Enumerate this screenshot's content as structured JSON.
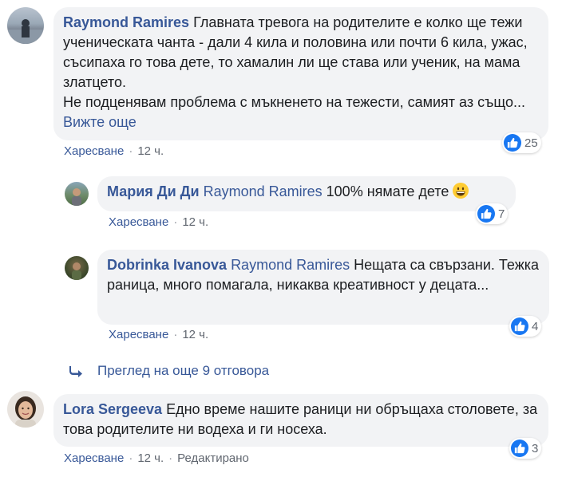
{
  "comments": [
    {
      "author": "Raymond Ramires",
      "text": "Главната тревога на родителите е колко ще тежи ученическата чанта - дали 4 кила и половина или почти 6 кила, ужас, съсипаха го това дете, то хамалин ли ще става или ученик, на мама златцето.",
      "text2": "Не подценявам проблема с мъкненето на тежести, самият аз също...",
      "see_more": "Вижте още",
      "like": "Харесване",
      "time": "12 ч.",
      "reactions": "25"
    },
    {
      "author": "Мария Ди Ди",
      "mention": "Raymond Ramires",
      "text": "100% нямате дете",
      "like": "Харесване",
      "time": "12 ч.",
      "reactions": "7"
    },
    {
      "author": "Dobrinka Ivanova",
      "mention": "Raymond Ramires",
      "text": "Нещата са свързани. Тежка раница, много помагала, никаква креативност у децата...",
      "like": "Харесване",
      "time": "12 ч.",
      "reactions": "4"
    },
    {
      "author": "Lora Sergeeva",
      "text": "Едно време нашите раници ни обръщаха столовете, за това родителите ни водеха и ги носеха.",
      "like": "Харесване",
      "time": "12 ч.",
      "edited": "Редактирано",
      "reactions": "3"
    }
  ],
  "more_replies": "Преглед на още 9 отговора",
  "colors": {
    "link": "#385898",
    "bubble": "#f2f3f5",
    "like_blue": "#1877f2"
  },
  "icons": [
    "like-icon",
    "reply-arrow-icon",
    "grinning-emoji-icon"
  ]
}
